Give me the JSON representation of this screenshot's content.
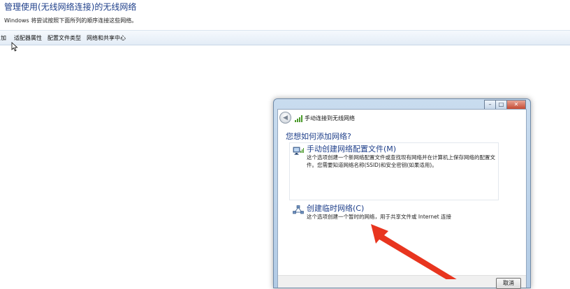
{
  "page": {
    "title": "管理使用(无线网络连接)的无线网络",
    "subtitle": "Windows 将尝试按照下面所列的顺序连接这些网络。"
  },
  "toolbar": {
    "items": [
      "加",
      "适配器属性",
      "配置文件类型",
      "网络和共享中心"
    ]
  },
  "dialog": {
    "title": "手动连接到无线网络",
    "question": "您想如何添加网络?",
    "options": [
      {
        "title": "手动创建网络配置文件(M)",
        "description": "这个选项创建一个新网络配置文件或查找现有网络并在计算机上保存网络的配置文件。您需要知道网络名称(SSID)和安全密钥(如果适用)。",
        "icon": "wireless-computer-icon"
      },
      {
        "title": "创建临时网络(C)",
        "description": "这个选项创建一个暂时的网络，用于共享文件或 Internet 连接",
        "icon": "adhoc-network-icon"
      }
    ],
    "cancel_label": "取消",
    "window_buttons": [
      "minimize",
      "maximize",
      "close"
    ]
  },
  "colors": {
    "title_blue": "#1e3f8a",
    "annotation_red": "#e8351f"
  }
}
